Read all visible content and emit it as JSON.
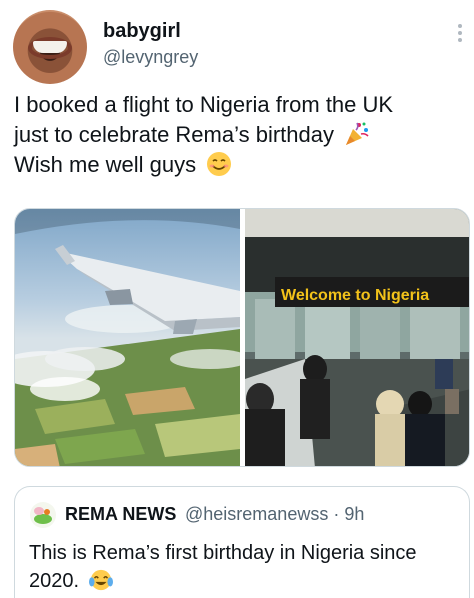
{
  "author": {
    "name": "babygirl",
    "handle": "@levyngrey"
  },
  "tweet": {
    "line1": "I booked a flight to Nigeria from the UK",
    "line2": "just to celebrate Rema’s birthday",
    "line3": "Wish me well guys",
    "emoji1": "party-popper-icon",
    "emoji2": "smiling-face-icon"
  },
  "media": {
    "left_image": "airplane-wing-over-clouds",
    "right_image": "airport-arrival-hall",
    "sign_text": "Welcome to Nigeria",
    "sign_color": "#1b1b1b",
    "sign_text_color": "#f2c21a"
  },
  "quoted": {
    "name": "REMA NEWS",
    "handle": "@heisremanewss · 9h",
    "line1": "This is Rema’s first birthday in Nigeria since",
    "line2": "2020.",
    "emoji": "tears-of-joy-icon"
  }
}
